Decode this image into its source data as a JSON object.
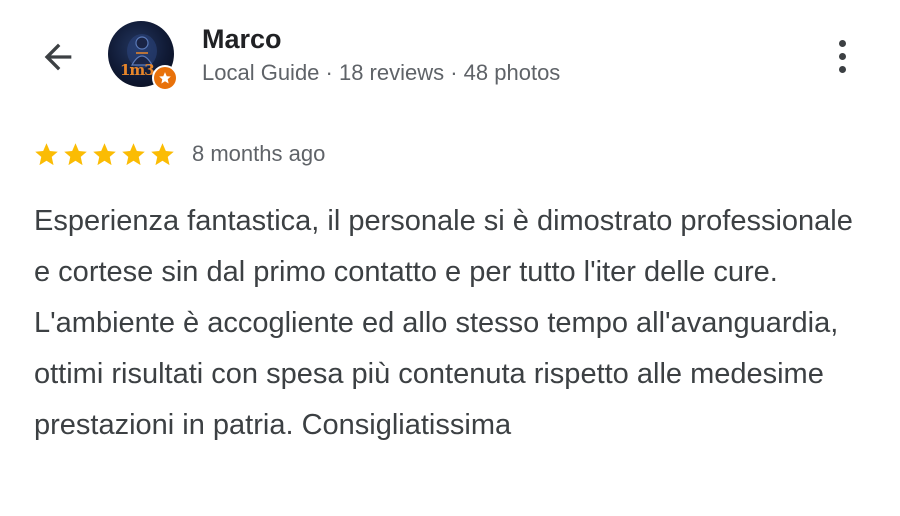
{
  "reviewer": {
    "name": "Marco",
    "meta": "Local Guide · 18 reviews · 48 photos",
    "avatar_text": "1m3",
    "badge_icon": "star-icon"
  },
  "review": {
    "rating": 5,
    "rating_max": 5,
    "date": "8 months ago",
    "text": "Esperienza fantastica, il personale si è dimostrato professionale e cortese sin dal primo contatto e per tutto l'iter delle cure. L'ambiente è accogliente ed allo stesso tempo all'avanguardia, ottimi risultati con spesa più contenuta rispetto alle medesime prestazioni in patria. Consigliatissima"
  },
  "icons": {
    "back": "arrow-back-icon",
    "more": "more-vert-icon"
  },
  "colors": {
    "star": "#fbbc04",
    "badge": "#e8710a",
    "name": "#202124",
    "meta": "#5f6368",
    "body": "#3c4043"
  }
}
